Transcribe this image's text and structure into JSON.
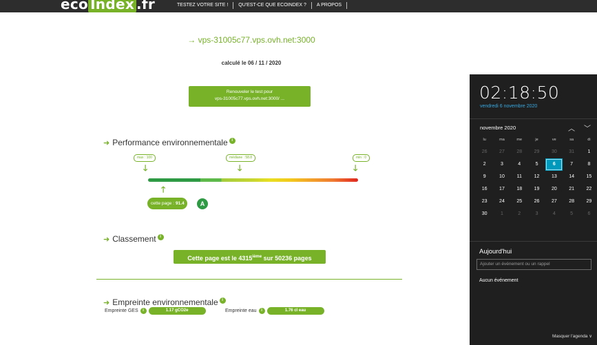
{
  "header": {
    "logo_left": "eco",
    "logo_highlight": "Index",
    "logo_right": ".fr",
    "nav": [
      "TESTEZ VOTRE SITE !",
      "QU'EST-CE QUE ECOINDEX ?",
      "A PROPOS"
    ]
  },
  "result": {
    "url": "→ vps-31005c77.vps.ovh.net:3000",
    "date": "calculé le 06 / 11 / 2020",
    "renew_line1": "Renouveler le test pour",
    "renew_line2": "vps-31005c77.vps.ovh.net:3000/ ..."
  },
  "performance": {
    "title": "Performance environnementale",
    "max_label": "max : 100",
    "median_label": "médiane : 58.8",
    "min_label": "min : 0",
    "page_label": "cette page :",
    "page_score": "91.4",
    "grade": "A"
  },
  "ranking": {
    "title": "Classement",
    "text_before": "Cette page est le ",
    "rank": "4315",
    "rank_suffix": "ième",
    "text_after": " sur 50236 pages"
  },
  "footprint": {
    "title": "Empreinte environnementale",
    "ges_label": "Empreinte GES",
    "ges_value": "1.17 gCO2e",
    "water_label": "Empreinte eau",
    "water_value": "1.76 cl eau"
  },
  "calendar": {
    "time": "02:18:50",
    "long_date": "vendredi 6 novembre 2020",
    "month_title": "novembre 2020",
    "weekdays": [
      "lu",
      "ma",
      "me",
      "je",
      "ve",
      "sa",
      "di"
    ],
    "weeks": [
      [
        "26",
        "27",
        "28",
        "29",
        "30",
        "31",
        "1"
      ],
      [
        "2",
        "3",
        "4",
        "5",
        "6",
        "7",
        "8"
      ],
      [
        "9",
        "10",
        "11",
        "12",
        "13",
        "14",
        "15"
      ],
      [
        "16",
        "17",
        "18",
        "19",
        "20",
        "21",
        "22"
      ],
      [
        "23",
        "24",
        "25",
        "26",
        "27",
        "28",
        "29"
      ],
      [
        "30",
        "1",
        "2",
        "3",
        "4",
        "5",
        "6"
      ]
    ],
    "today": "6",
    "agenda_title": "Aujourd'hui",
    "agenda_placeholder": "Ajouter un événement ou un rappel",
    "no_event": "Aucun événement",
    "hide_agenda": "Masquer l'agenda ∨"
  },
  "colors": {
    "accent": "#77b229",
    "dark_header": "#2d2d2d",
    "flyout_bg": "#1f1f1f",
    "today_highlight": "#0099bc",
    "date_link": "#39a9e0"
  }
}
